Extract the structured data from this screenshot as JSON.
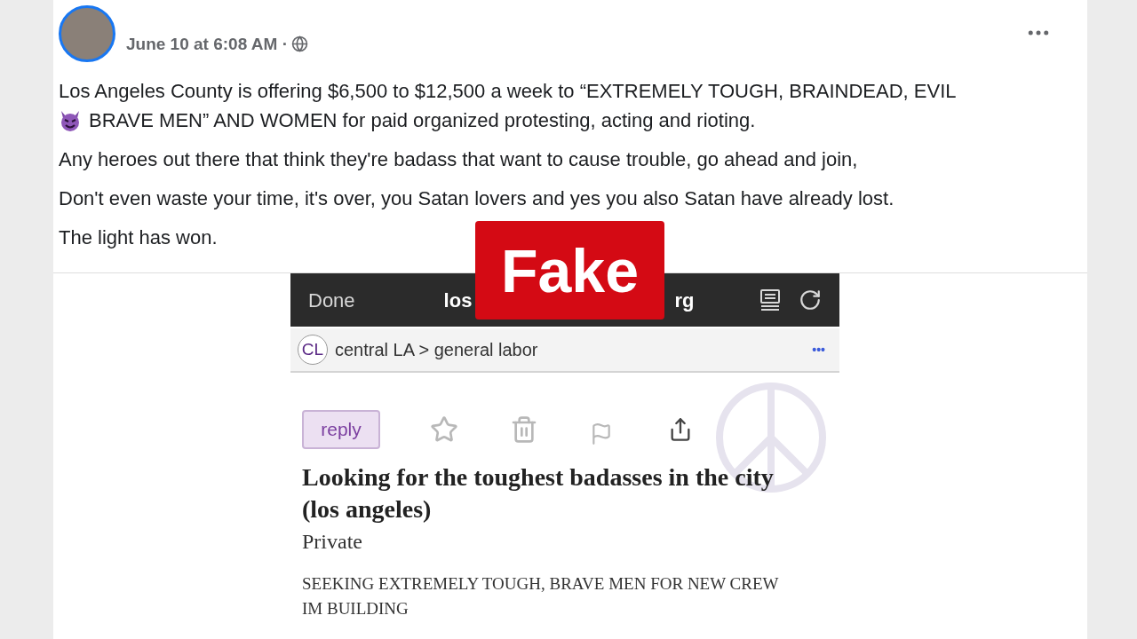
{
  "post": {
    "timestamp": "June 10 at 6:08 AM ·",
    "paragraphs": [
      {
        "kind": "with-emoji",
        "before": "Los Angeles County is offering $6,500 to $12,500 a week to “EXTREMELY TOUGH, BRAINDEAD, EVIL",
        "after": "BRAVE MEN” AND WOMEN for paid organized protesting, acting and rioting."
      },
      {
        "kind": "plain",
        "text": "Any heroes out there that think they're badass that want to cause trouble, go ahead and join,"
      },
      {
        "kind": "plain",
        "text": "Don't even waste your time, it's over, you Satan lovers and yes you also Satan have already lost."
      },
      {
        "kind": "plain",
        "text": "The light has won."
      }
    ]
  },
  "embedded": {
    "browser_bar": {
      "done": "Done",
      "url_start": "los",
      "url_end": "rg"
    },
    "breadcrumb": {
      "badge": "CL",
      "path": "central LA > general labor",
      "more": "•••"
    },
    "reply": "reply",
    "title": "Looking for the toughest badasses in the city (los angeles)",
    "subtitle": "Private",
    "body": "SEEKING EXTREMELY TOUGH, BRAVE MEN FOR NEW CREW IM BUILDING"
  },
  "label": {
    "text": "Fake"
  }
}
